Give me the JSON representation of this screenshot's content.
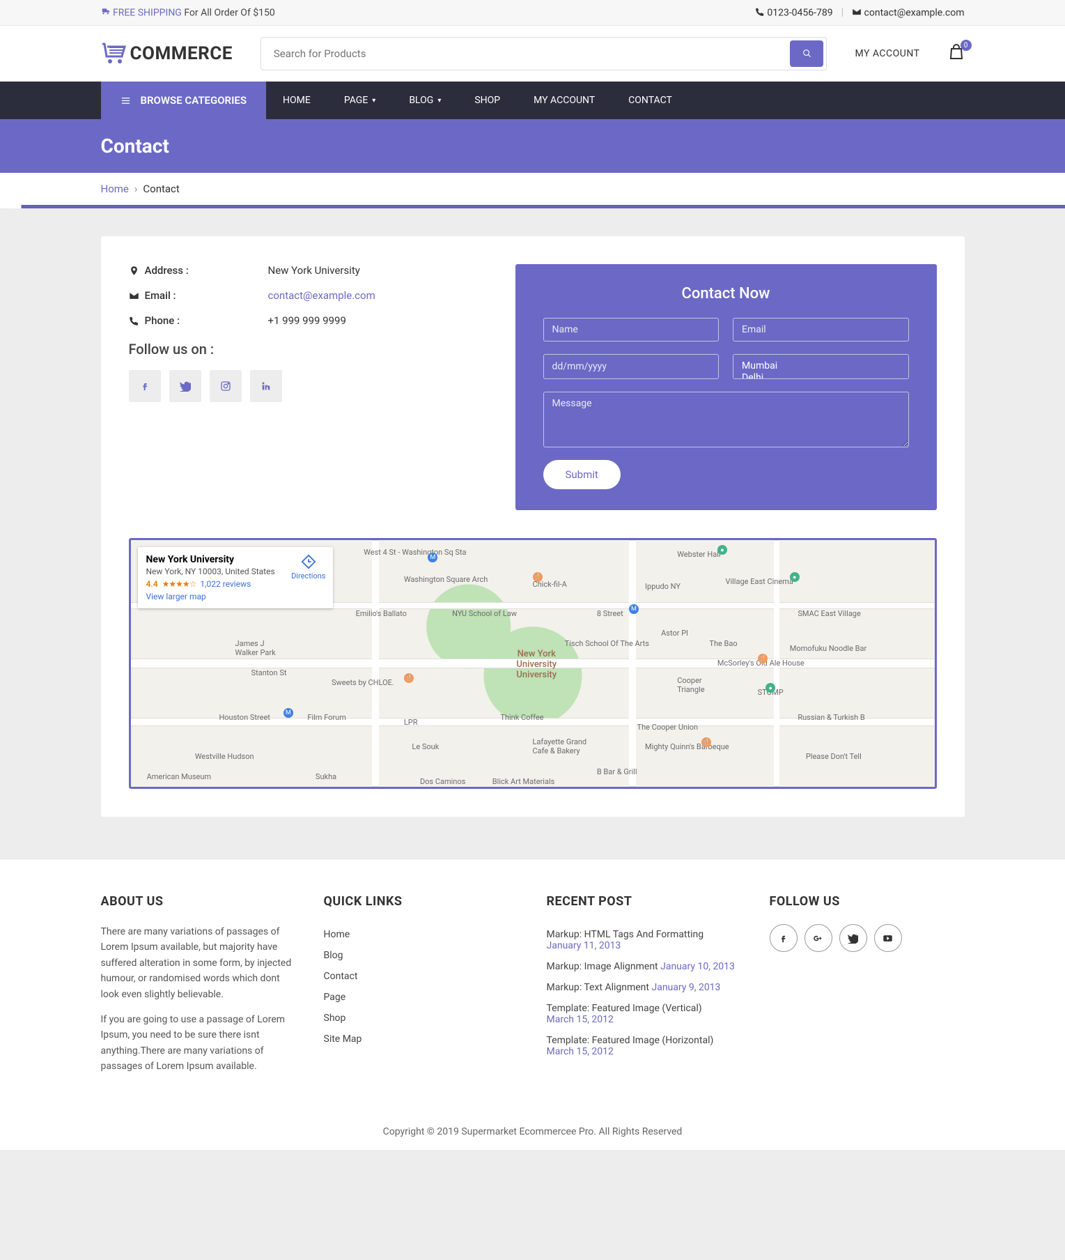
{
  "topbar": {
    "shipping_link": "FREE SHIPPING",
    "shipping_rest": " For All Order Of $150",
    "phone": "0123-0456-789",
    "email": "contact@example.com"
  },
  "header": {
    "logo_text": "COMMERCE",
    "search_placeholder": "Search for Products",
    "my_account": "MY ACCOUNT",
    "cart_count": "0"
  },
  "nav": {
    "browse": "BROWSE CATEGORIES",
    "items": [
      "HOME",
      "PAGE",
      "BLOG",
      "SHOP",
      "MY ACCOUNT",
      "CONTACT"
    ]
  },
  "page": {
    "title": "Contact",
    "crumb_home": "Home",
    "crumb_current": "Contact"
  },
  "contact": {
    "labels": {
      "address": "Address :",
      "email": "Email :",
      "phone": "Phone :"
    },
    "address": "New York University",
    "email": "contact@example.com",
    "phone": "+1 999 999 9999",
    "follow_heading": "Follow us on :"
  },
  "form": {
    "title": "Contact Now",
    "name_ph": "Name",
    "email_ph": "Email",
    "date_ph": "dd/mm/yyyy",
    "select_opts": [
      "Mumbai",
      "Delhi"
    ],
    "message_ph": "Message",
    "submit": "Submit"
  },
  "map": {
    "title": "New York University",
    "addr": "New York, NY 10003, United States",
    "rating": "4.4",
    "reviews": "1,022 reviews",
    "larger": "View larger map",
    "directions": "Directions",
    "labels": {
      "wash": "Washington Square Arch",
      "nyu": "NYU School of Law",
      "tisch": "Tisch School Of The Arts",
      "houston": "Houston Street",
      "west4": "West 4 St - Washington Sq Sta",
      "chick": "Chick-fil-A",
      "ippudo": "Ippudo NY",
      "webster": "Webster Hall",
      "village": "Village East Cinema",
      "smac": "SMAC East Village",
      "astor": "Astor Pl",
      "eight": "8 Street",
      "james": "James J\nWalker Park",
      "sweets": "Sweets by CHLOE.",
      "film": "Film Forum",
      "lpr": "LPR",
      "lesouk": "Le Souk",
      "coffee": "Think Coffee",
      "lafg": "Lafayette Grand\nCafe & Bakery",
      "cooperu": "The Cooper Union",
      "cooper": "Cooper\nTriangle",
      "stomp": "STOMP",
      "russian": "Russian & Turkish B",
      "msorley": "McSorley's Old Ale House",
      "bao": "The Bao",
      "mortys": "Mighty Quinn's Barbeque",
      "bbar": "B Bar & Grill",
      "blick": "Blick Art Materials",
      "westville": "Westville Hudson",
      "stanton": "Stanton St",
      "sukha": "Sukha",
      "dos": "Dos Caminos",
      "american": "American Museum",
      "emilio": "Emilio's Ballato",
      "noodle": "Momofuku Noodle Bar",
      "dont": "Please Don't Tell",
      "center": "New York\nUniversity\nUniversity"
    }
  },
  "footer": {
    "about_h": "ABOUT US",
    "about_p1": "There are many variations of passages of Lorem Ipsum available, but majority have suffered alteration in some form, by injected humour, or randomised words which dont look even slightly believable.",
    "about_p2": "If you are going to use a passage of Lorem Ipsum, you need to be sure there isnt anything.There are many variations of passages of Lorem Ipsum available.",
    "quick_h": "QUICK LINKS",
    "quick": [
      "Home",
      "Blog",
      "Contact",
      "Page",
      "Shop",
      "Site Map"
    ],
    "recent_h": "RECENT POST",
    "recent": [
      {
        "t": "Markup: HTML Tags And Formatting",
        "d": "January 11, 2013"
      },
      {
        "t": "Markup: Image Alignment",
        "d": "January 10, 2013"
      },
      {
        "t": "Markup: Text Alignment",
        "d": "January 9, 2013"
      },
      {
        "t": "Template: Featured Image (Vertical)",
        "d": "March 15, 2012"
      },
      {
        "t": "Template: Featured Image (Horizontal)",
        "d": "March 15, 2012"
      }
    ],
    "follow_h": "FOLLOW US",
    "copyright": "Copyright © 2019 Supermarket Ecommercee Pro. All Rights Reserved"
  }
}
